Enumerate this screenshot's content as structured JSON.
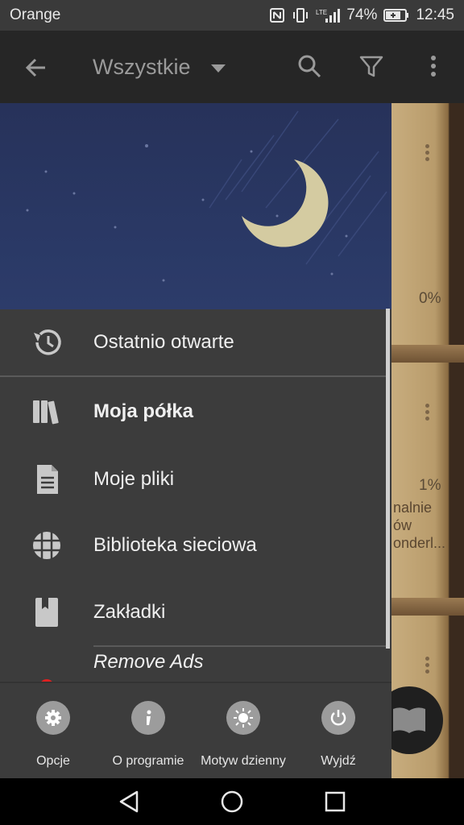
{
  "status_bar": {
    "carrier": "Orange",
    "battery": "74%",
    "time": "12:45"
  },
  "appbar": {
    "title": "Wszystkie"
  },
  "background": {
    "pct_1": "0%",
    "pct_2": "1%",
    "snippet_1": "nalnie",
    "snippet_2": "ów",
    "snippet_3": "onderl..."
  },
  "menu": {
    "items": [
      {
        "label": "Ostatnio otwarte",
        "icon": "history-icon"
      },
      {
        "label": "Moja półka",
        "icon": "books-icon"
      },
      {
        "label": "Moje pliki",
        "icon": "file-icon"
      },
      {
        "label": "Biblioteka sieciowa",
        "icon": "globe-icon"
      },
      {
        "label": "Zakładki",
        "icon": "bookmark-icon"
      },
      {
        "label": "Remove Ads",
        "icon": "red-dot-icon"
      }
    ]
  },
  "bottom_bar": {
    "items": [
      {
        "label": "Opcje",
        "icon": "gear-icon"
      },
      {
        "label": "O programie",
        "icon": "info-icon"
      },
      {
        "label": "Motyw dzienny",
        "icon": "sun-icon"
      },
      {
        "label": "Wyjdź",
        "icon": "power-icon"
      }
    ]
  }
}
